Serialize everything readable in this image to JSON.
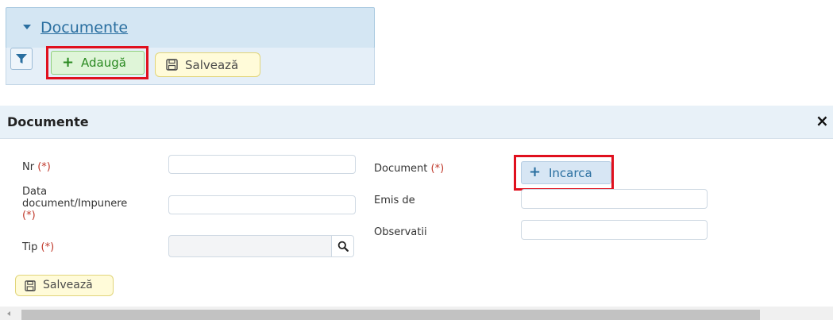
{
  "top_panel": {
    "title": "Documente",
    "add_label": "Adaugă",
    "save_label": "Salvează"
  },
  "dialog": {
    "title": "Documente",
    "close_glyph": "×",
    "required_marker": "(*)",
    "fields": {
      "nr": {
        "label": "Nr",
        "value": "",
        "placeholder": ""
      },
      "data_document": {
        "label_line1": "Data",
        "label_line2": "document/Impunere",
        "value": "",
        "placeholder": ""
      },
      "tip": {
        "label": "Tip",
        "value": "",
        "placeholder": ""
      },
      "document": {
        "label": "Document"
      },
      "emis_de": {
        "label": "Emis de",
        "value": "",
        "placeholder": ""
      },
      "observatii": {
        "label": "Observatii",
        "value": "",
        "placeholder": ""
      }
    },
    "upload_label": "Incarca",
    "save_label": "Salvează"
  },
  "icons": {
    "filter": "filter-icon",
    "plus": "plus-icon",
    "save": "save-icon",
    "search": "search-icon",
    "close": "close-icon",
    "collapse": "caret-down-icon"
  },
  "colors": {
    "highlight": "#e0101e",
    "header_bg": "#d4e6f3",
    "link_blue": "#2a6fa0",
    "add_green": "#2b8a22",
    "save_yellow": "#fffbd9"
  }
}
